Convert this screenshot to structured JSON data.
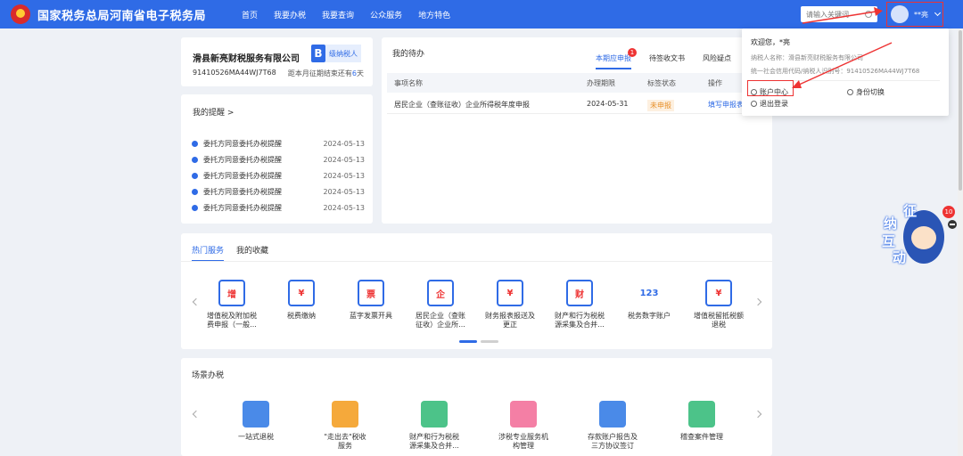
{
  "header": {
    "brand": "国家税务总局河南省电子税务局",
    "nav": [
      "首页",
      "我要办税",
      "我要查询",
      "公众服务",
      "地方特色"
    ],
    "search_placeholder": "请输入关键词",
    "user_name": "**亮"
  },
  "company": {
    "name": "滑县新亮财税服务有限公司",
    "badge_letter": "B",
    "badge_text": "级纳税人",
    "tax_id": "91410526MA44WJ7T68",
    "deadline_prefix": "距本月征期结束还有",
    "deadline_days": "6",
    "deadline_suffix": "天"
  },
  "reminders": {
    "title": "我的提醒 >",
    "items": [
      {
        "label": "委托方同意委托办税提醒",
        "date": "2024-05-13"
      },
      {
        "label": "委托方同意委托办税提醒",
        "date": "2024-05-13"
      },
      {
        "label": "委托方同意委托办税提醒",
        "date": "2024-05-13"
      },
      {
        "label": "委托方同意委托办税提醒",
        "date": "2024-05-13"
      },
      {
        "label": "委托方同意委托办税提醒",
        "date": "2024-05-13"
      }
    ]
  },
  "todo": {
    "title": "我的待办",
    "tabs": [
      "本期应申报",
      "待签收文书",
      "风险疑点"
    ],
    "tab_badge": "1",
    "columns": [
      "事项名称",
      "办理期限",
      "标签状态",
      "操作"
    ],
    "row": {
      "name": "居民企业（查账征收）企业所得税年度申报",
      "deadline": "2024-05-31",
      "status": "未申报",
      "action": "填写申报表"
    }
  },
  "dropdown": {
    "welcome": "欢迎您，*亮",
    "taxpayer_name": "纳税人名称：滑县新亮财税服务有限公司",
    "credit_code": "统一社会信用代码/纳税人识别号：91410526MA44WJ7T68",
    "account_center": "账户中心",
    "switch_identity": "身份切换",
    "logout": "退出登录"
  },
  "hot": {
    "tabs": [
      "热门服务",
      "我的收藏"
    ],
    "services": [
      {
        "icon": "增",
        "line1": "增值税及附加税",
        "line2": "费申报（一般..."
      },
      {
        "icon": "¥",
        "line1": "税费缴纳",
        "line2": ""
      },
      {
        "icon": "票",
        "line1": "蓝字发票开具",
        "line2": ""
      },
      {
        "icon": "企",
        "line1": "居民企业（查账",
        "line2": "征收）企业所..."
      },
      {
        "icon": "¥",
        "line1": "财务报表报送及",
        "line2": "更正"
      },
      {
        "icon": "财",
        "line1": "财产和行为税税",
        "line2": "源采集及合并..."
      },
      {
        "icon": "123",
        "line1": "税务数字账户",
        "line2": ""
      },
      {
        "icon": "¥",
        "line1": "增值税留抵税额",
        "line2": "退税"
      }
    ]
  },
  "scene": {
    "title": "场景办税",
    "items": [
      {
        "line1": "一站式退税",
        "line2": "",
        "color": "#4a8ae8"
      },
      {
        "line1": "\"走出去\"税收",
        "line2": "服务",
        "color": "#f5a93b"
      },
      {
        "line1": "财产和行为税税",
        "line2": "源采集及合并...",
        "color": "#4cc389"
      },
      {
        "line1": "涉税专业服务机",
        "line2": "构管理",
        "color": "#f47fa5"
      },
      {
        "line1": "存款账户报告及",
        "line2": "三方协议签订",
        "color": "#4a8ae8"
      },
      {
        "line1": "稽查案件管理",
        "line2": "",
        "color": "#4cc389"
      }
    ]
  },
  "mascot": {
    "chars": [
      "征",
      "纳",
      "互",
      "动"
    ],
    "badge": "10"
  },
  "colors": {
    "primary": "#2f6be6",
    "alert": "#e33333"
  }
}
